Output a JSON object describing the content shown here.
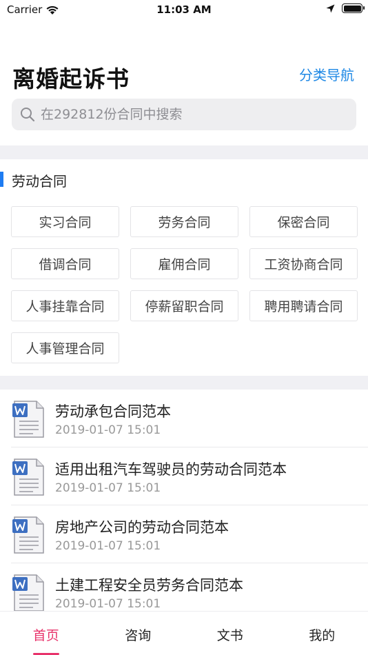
{
  "status_bar": {
    "carrier": "Carrier",
    "time": "11:03 AM"
  },
  "header": {
    "title": "离婚起诉书",
    "nav_link": "分类导航"
  },
  "search": {
    "placeholder": "在292812份合同中搜索"
  },
  "section": {
    "title": "劳动合同",
    "accent_color": "#1e7cf2",
    "tags": [
      "实习合同",
      "劳务合同",
      "保密合同",
      "借调合同",
      "雇佣合同",
      "工资协商合同",
      "人事挂靠合同",
      "停薪留职合同",
      "聘用聘请合同",
      "人事管理合同"
    ]
  },
  "documents": [
    {
      "title": "劳动承包合同范本",
      "date": "2019-01-07 15:01",
      "icon": "word-document-icon"
    },
    {
      "title": "适用出租汽车驾驶员的劳动合同范本",
      "date": "2019-01-07 15:01",
      "icon": "word-document-icon"
    },
    {
      "title": "房地产公司的劳动合同范本",
      "date": "2019-01-07 15:01",
      "icon": "word-document-icon"
    },
    {
      "title": "土建工程安全员劳务合同范本",
      "date": "2019-01-07 15:01",
      "icon": "word-document-icon"
    }
  ],
  "tab_bar": {
    "active_color": "#e8336b",
    "tabs": [
      {
        "label": "首页",
        "active": true
      },
      {
        "label": "咨询",
        "active": false
      },
      {
        "label": "文书",
        "active": false
      },
      {
        "label": "我的",
        "active": false
      }
    ]
  }
}
